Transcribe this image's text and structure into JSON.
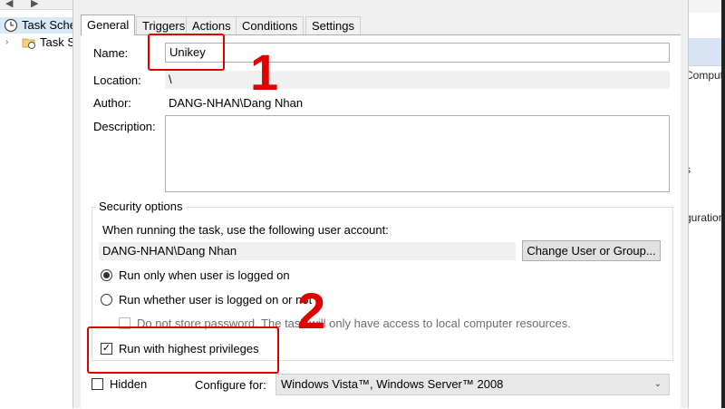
{
  "background": {
    "tree": [
      {
        "label": "Task Scheduler (Local)",
        "selected": true
      },
      {
        "label": "Task Scheduler Library",
        "selected": false
      }
    ],
    "right_fragments": [
      "Computer...",
      "s",
      "guration"
    ]
  },
  "tabs": [
    "General",
    "Triggers",
    "Actions",
    "Conditions",
    "Settings"
  ],
  "active_tab": "General",
  "general": {
    "name_label": "Name:",
    "name_value": "Unikey",
    "location_label": "Location:",
    "location_value": "\\",
    "author_label": "Author:",
    "author_value": "DANG-NHAN\\Dang Nhan",
    "description_label": "Description:",
    "description_value": ""
  },
  "security": {
    "caption": "Security options",
    "account_prompt": "When running the task, use the following user account:",
    "account_value": "DANG-NHAN\\Dang Nhan",
    "change_button": "Change User or Group...",
    "radio_logged_on": "Run only when user is logged on",
    "radio_whether": "Run whether user is logged on or not",
    "selected_radio": "Run only when user is logged on",
    "no_store_password": "Do not store password.  The task will only have access to local computer resources.",
    "no_store_password_checked": false,
    "highest_privileges": "Run with highest privileges",
    "highest_privileges_checked": true
  },
  "bottom": {
    "hidden_label": "Hidden",
    "hidden_checked": false,
    "configure_label": "Configure for:",
    "configure_value": "Windows Vista™, Windows Server™ 2008"
  },
  "annotations": {
    "marker_1": "1",
    "marker_2": "2",
    "color": "#e00000"
  },
  "icons": [
    "back-arrow-icon",
    "forward-arrow-icon",
    "clock-icon",
    "folder-clock-icon",
    "expand-chevron-icon",
    "checkmark-icon",
    "dropdown-chevron-icon"
  ]
}
